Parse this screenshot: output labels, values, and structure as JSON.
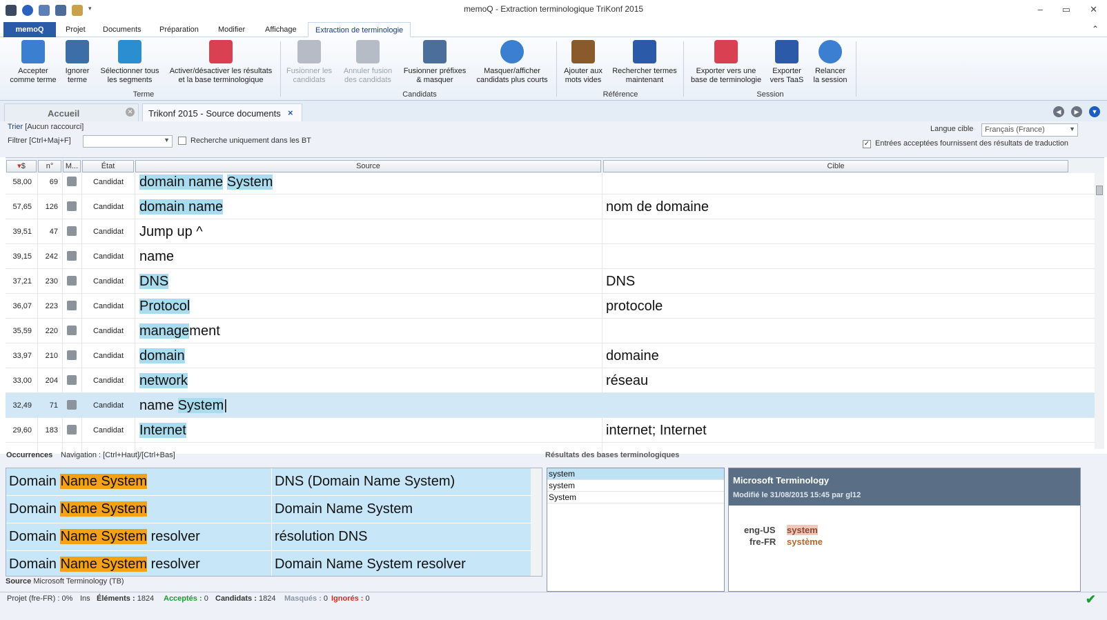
{
  "window": {
    "title": "memoQ - Extraction terminologique TriKonf 2015",
    "controls": [
      "–",
      "▭",
      "✕"
    ]
  },
  "tabs": [
    "memoQ",
    "Projet",
    "Documents",
    "Préparation",
    "Modifier",
    "Affichage",
    "Extraction de terminologie"
  ],
  "ribbon": {
    "buttons": [
      {
        "label1": "Accepter",
        "label2": "comme terme",
        "icon": "accept-icon",
        "color": "#3a7fd0"
      },
      {
        "label1": "Ignorer",
        "label2": "terme",
        "icon": "trash-icon",
        "color": "#3d6ea8"
      },
      {
        "label1": "Sélectionner tous",
        "label2": "les segments",
        "icon": "list-icon",
        "color": "#2b8ed0"
      },
      {
        "label1": "Activer/désactiver les résultats",
        "label2": "et la base terminologique",
        "icon": "toggle-icon",
        "color": "#d94052"
      },
      {
        "label1": "Fusionner les",
        "label2": "candidats",
        "icon": "merge-icon",
        "color": "#9aa3ad"
      },
      {
        "label1": "Annuler fusion",
        "label2": "des candidats",
        "icon": "unmerge-icon",
        "color": "#9aa3ad"
      },
      {
        "label1": "Fusionner préfixes",
        "label2": "& masquer",
        "icon": "merge-prefix-icon",
        "color": "#4b6f9a"
      },
      {
        "label1": "Masquer/afficher",
        "label2": "candidats plus courts",
        "icon": "eye-icon",
        "color": "#3a7fd0"
      },
      {
        "label1": "Ajouter aux",
        "label2": "mots vides",
        "icon": "abc-icon",
        "color": "#8b5a2b"
      },
      {
        "label1": "Rechercher termes",
        "label2": "maintenant",
        "icon": "binoculars-icon",
        "color": "#2b5aa8"
      },
      {
        "label1": "Exporter vers une",
        "label2": "base de terminologie",
        "icon": "export-tb-icon",
        "color": "#d94052"
      },
      {
        "label1": "Exporter",
        "label2": "vers TaaS",
        "icon": "taas-icon",
        "color": "#2b5aa8"
      },
      {
        "label1": "Relancer",
        "label2": "la session",
        "icon": "restart-icon",
        "color": "#3a7fd0"
      }
    ],
    "groups": [
      "Terme",
      "Candidats",
      "Référence",
      "Session"
    ]
  },
  "doctabs": {
    "home": "Accueil",
    "current": "Trikonf 2015 - Source documents",
    "close": "×"
  },
  "filter": {
    "sort_label": "Trier",
    "sort_value": "[Aucun raccourci]",
    "filter_label": "Filtrer",
    "filter_shortcut": "[Ctrl+Maj+F]",
    "filter_value": "",
    "tb_only": "Recherche uniquement dans les BT",
    "target_lang_label": "Langue cible",
    "target_lang_value": "Français (France)",
    "accepted_entries": "Entrées acceptées fournissent des résultats de traduction"
  },
  "grid": {
    "headers": [
      "$",
      "n°",
      "M...",
      "État",
      "Source",
      "Cible"
    ],
    "rows": [
      {
        "score": "58,00",
        "n": "69",
        "state": "Candidat",
        "source": "domain name System",
        "target": ""
      },
      {
        "score": "57,65",
        "n": "126",
        "state": "Candidat",
        "source": "domain name",
        "target": "nom de domaine"
      },
      {
        "score": "39,51",
        "n": "47",
        "state": "Candidat",
        "source": "Jump up ^",
        "target": ""
      },
      {
        "score": "39,15",
        "n": "242",
        "state": "Candidat",
        "source": "name",
        "target": ""
      },
      {
        "score": "37,21",
        "n": "230",
        "state": "Candidat",
        "source": "DNS",
        "target": "DNS"
      },
      {
        "score": "36,07",
        "n": "223",
        "state": "Candidat",
        "source": "Protocol",
        "target": "protocole"
      },
      {
        "score": "35,59",
        "n": "220",
        "state": "Candidat",
        "source": "management",
        "target": ""
      },
      {
        "score": "33,97",
        "n": "210",
        "state": "Candidat",
        "source": "domain",
        "target": "domaine"
      },
      {
        "score": "33,00",
        "n": "204",
        "state": "Candidat",
        "source": "network",
        "target": "réseau"
      },
      {
        "score": "32,49",
        "n": "71",
        "state": "Candidat",
        "source": "name System",
        "target": ""
      },
      {
        "score": "29,60",
        "n": "183",
        "state": "Candidat",
        "source": "Internet",
        "target": "internet; Internet"
      }
    ]
  },
  "occurrences": {
    "title": "Occurrences",
    "nav": "Navigation : [Ctrl+Haut]/[Ctrl+Bas]",
    "rows": [
      {
        "pre": "Domain ",
        "hit": "Name System",
        "post": "",
        "target": "DNS (Domain Name System)"
      },
      {
        "pre": "Domain ",
        "hit": "Name System",
        "post": "",
        "target": "Domain Name System"
      },
      {
        "pre": "Domain ",
        "hit": "Name System",
        "post": " resolver",
        "target": "résolution DNS"
      },
      {
        "pre": "Domain ",
        "hit": "Name System",
        "post": " resolver",
        "target": "Domain Name System resolver"
      }
    ],
    "source_label": "Source",
    "source_value": "Microsoft Terminology (TB)"
  },
  "tb_results": {
    "title": "Résultats des bases terminologiques",
    "items": [
      "system",
      "system",
      "System"
    ],
    "detail_title": "Microsoft Terminology",
    "modified": "Modifié le 31/08/2015 15:45 par gl12",
    "entries": [
      {
        "lang": "eng-US",
        "term": "system"
      },
      {
        "lang": "fre-FR",
        "term": "système"
      }
    ]
  },
  "status": {
    "project": "Projet (fre-FR) : 0%",
    "mode": "Ins",
    "elements_label": "Éléments :",
    "elements": "1824",
    "accepted_label": "Acceptés :",
    "accepted": "0",
    "candidates_label": "Candidats :",
    "candidates": "1824",
    "hidden_label": "Masqués :",
    "hidden": "0",
    "ignored_label": "Ignorés :",
    "ignored": "0",
    "check": "✔"
  }
}
